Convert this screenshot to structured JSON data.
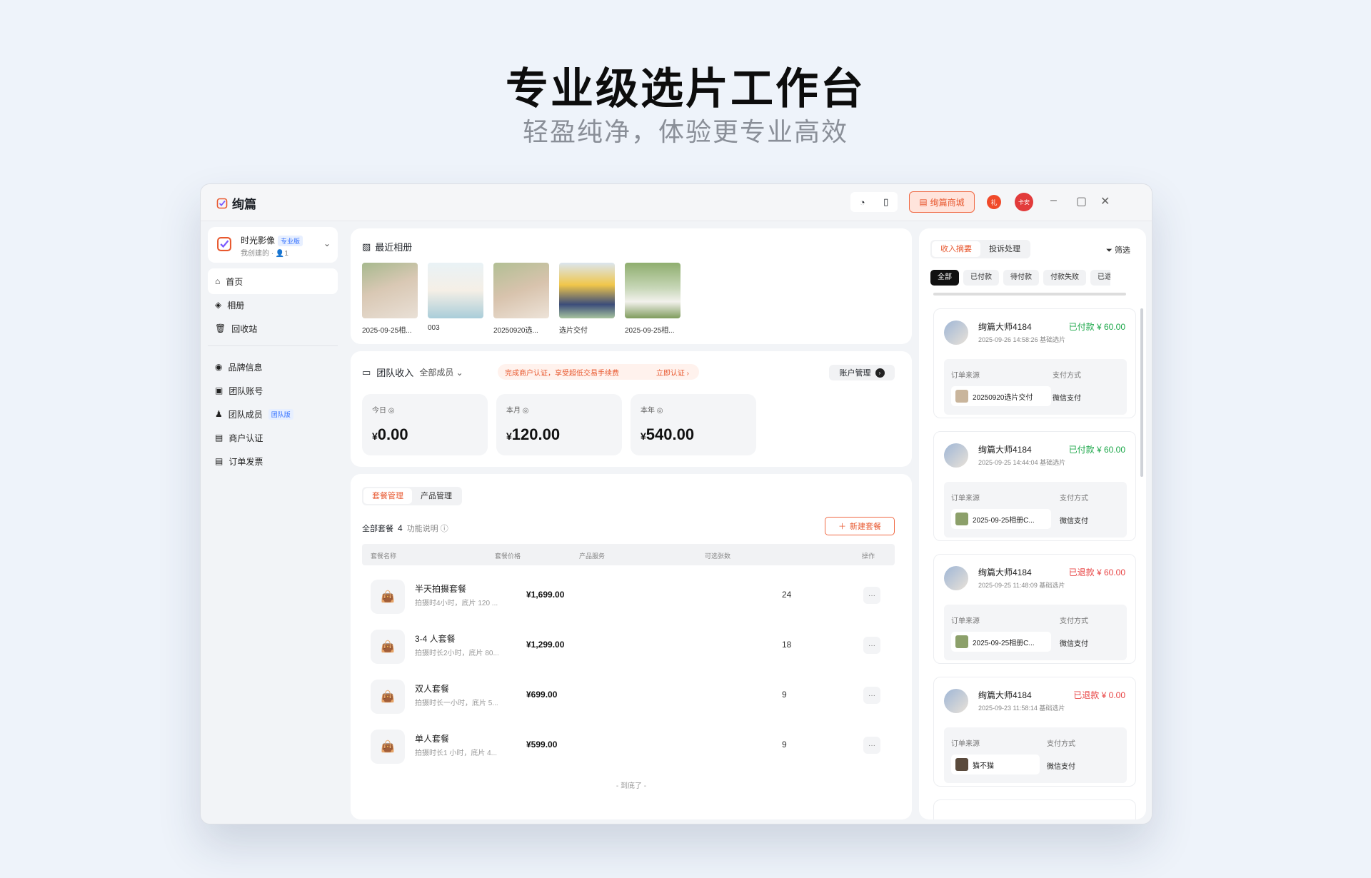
{
  "hero": {
    "title": "专业级选片工作台",
    "subtitle": "轻盈纯净，体验更专业高效"
  },
  "app": {
    "name": "绚篇",
    "shop_label": "绚篇商城",
    "bell_badge": "礼",
    "user_avatar": "卡安"
  },
  "studio": {
    "name": "时光影像",
    "plan_tag": "专业版",
    "meta": "我创建的 · 👤1"
  },
  "nav": {
    "items": [
      {
        "label": "首页"
      },
      {
        "label": "相册"
      },
      {
        "label": "回收站"
      },
      {
        "label": "品牌信息"
      },
      {
        "label": "团队账号"
      },
      {
        "label": "团队成员",
        "tag": "团队版"
      },
      {
        "label": "商户认证"
      },
      {
        "label": "订单发票"
      }
    ]
  },
  "albums": {
    "title": "最近相册",
    "items": [
      {
        "caption": "2025-09-25相..."
      },
      {
        "caption": "003"
      },
      {
        "caption": "20250920选..."
      },
      {
        "caption": "选片交付"
      },
      {
        "caption": "2025-09-25相..."
      }
    ]
  },
  "income": {
    "title": "团队收入",
    "member_filter": "全部成员",
    "banner_text": "完成商户认证，享受超低交易手续费",
    "banner_cta": "立即认证 ›",
    "account_button": "账户管理",
    "stats": [
      {
        "label": "今日",
        "currency": "¥",
        "value": "0.00"
      },
      {
        "label": "本月",
        "currency": "¥",
        "value": "120.00"
      },
      {
        "label": "本年",
        "currency": "¥",
        "value": "540.00"
      }
    ]
  },
  "packages": {
    "tabs": [
      "套餐管理",
      "产品管理"
    ],
    "header_label": "全部套餐",
    "count": "4",
    "help": "功能说明",
    "new_button": "新建套餐",
    "columns": [
      "套餐名称",
      "套餐价格",
      "产品服务",
      "可选张数",
      "操作"
    ],
    "rows": [
      {
        "name": "半天拍摄套餐",
        "desc": "拍摄时4小时，底片 120 ...",
        "price": "¥1,699.00",
        "qty": "24"
      },
      {
        "name": "3-4 人套餐",
        "desc": "拍摄时长2小时，底片 80...",
        "price": "¥1,299.00",
        "qty": "18"
      },
      {
        "name": "双人套餐",
        "desc": "拍摄时长一小时，底片 5...",
        "price": "¥699.00",
        "qty": "9"
      },
      {
        "name": "单人套餐",
        "desc": "拍摄时长1 小时，底片 4...",
        "price": "¥599.00",
        "qty": "9"
      }
    ],
    "end_text": "- 到底了 -"
  },
  "orders_panel": {
    "tabs": [
      "收入摘要",
      "投诉处理"
    ],
    "filter": "筛选",
    "chips": [
      "全部",
      "已付款",
      "待付款",
      "付款失败",
      "已退款"
    ],
    "source_label": "订单来源",
    "pay_label": "支付方式",
    "orders": [
      {
        "user": "绚篇大师4184",
        "status": "已付款 ¥ 60.00",
        "time": "2025-09-26 14:58:26 基础选片",
        "source": "20250920选片交付",
        "pay": "微信支付"
      },
      {
        "user": "绚篇大师4184",
        "status": "已付款 ¥ 60.00",
        "time": "2025-09-25 14:44:04 基础选片",
        "source": "2025-09-25相册C...",
        "pay": "微信支付"
      },
      {
        "user": "绚篇大师4184",
        "status": "已退款 ¥ 60.00",
        "time": "2025-09-25 11:48:09 基础选片",
        "source": "2025-09-25相册C...",
        "pay": "微信支付"
      },
      {
        "user": "绚篇大师4184",
        "status": "已退款 ¥ 0.00",
        "time": "2025-09-23 11:58:14 基础选片",
        "source": "猫不猫",
        "pay": "微信支付"
      }
    ]
  },
  "colors": {
    "accent": "#e85a32",
    "success": "#1ea84b",
    "danger": "#e84545",
    "brand_blue": "#3370ff"
  }
}
